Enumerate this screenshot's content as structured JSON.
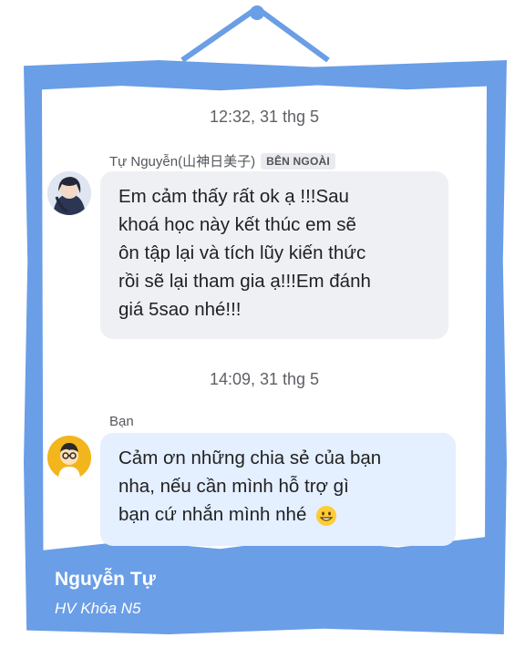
{
  "theme": {
    "frame_color": "#6a9ee6",
    "incoming_bubble": "#eef0f4",
    "outgoing_bubble": "#e4efff"
  },
  "chat": {
    "messages": [
      {
        "timestamp": "12:32, 31 thg 5",
        "sender": "Tự Nguyễn(山神日美子)",
        "badge": "BÊN NGOÀI",
        "avatar_icon": "anime-girl-avatar-icon",
        "lines": [
          "Em cảm thấy rất ok ạ !!!Sau",
          "khoá học này kết thúc em sẽ",
          "ôn tập lại và tích lũy kiến thức",
          "rồi sẽ lại tham gia ạ!!!Em đánh",
          "giá 5sao nhé!!!"
        ]
      },
      {
        "timestamp": "14:09, 31 thg 5",
        "sender": "Bạn",
        "avatar_icon": "cartoon-boy-avatar-icon",
        "lines": [
          "Cảm ơn những chia sẻ của bạn",
          "nha, nếu cần mình hỗ trợ gì",
          "bạn cứ nhắn mình nhé"
        ],
        "emoji": "smiling-face-emoji-icon"
      }
    ]
  },
  "caption": {
    "name": "Nguyễn Tự",
    "subtitle": "HV Khóa N5"
  }
}
